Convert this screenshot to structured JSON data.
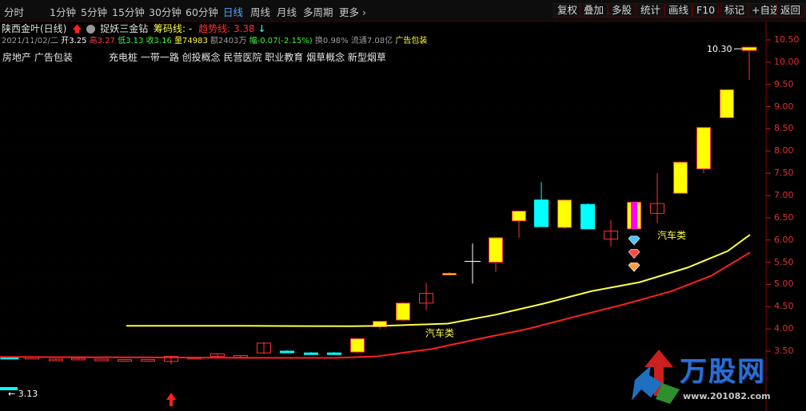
{
  "toolbar": {
    "period_tabs": [
      "分时",
      "1分钟",
      "5分钟",
      "15分钟",
      "30分钟",
      "60分钟",
      "日线",
      "周线",
      "月线",
      "多周期",
      "更多"
    ],
    "active_tab": "日线",
    "right_buttons": [
      "复权",
      "叠加",
      "多股",
      "统计",
      "画线",
      "F10",
      "标记",
      "+自选",
      "返回"
    ]
  },
  "header": {
    "stock": "陕西金叶(日线)",
    "indicator": "捉妖三金钻",
    "chip_label": "筹码线: -",
    "trend_label": "趋势线:",
    "trend_value": "3.38",
    "info_date": "2021/11/02/二",
    "info_open": "开3.25",
    "info_high": "高3.27",
    "info_low": "低3.13",
    "info_close": "收3.16",
    "info_vol": "量74983",
    "info_amt": "额2403万",
    "info_chg": "幅-0.07(-2.15%)",
    "info_turn": "换0.98%",
    "info_float": "流通7.08亿",
    "info_concept": "广告包装"
  },
  "concepts": {
    "left": "房地产 广告包装",
    "right": "充电桩 一带一路 创投概念 民营医院 职业教育 烟草概念 新型烟草"
  },
  "price_axis": [
    "10.50",
    "10.00",
    "9.50",
    "9.00",
    "8.50",
    "8.00",
    "7.50",
    "7.00",
    "6.50",
    "6.00",
    "5.50",
    "5.00",
    "4.50",
    "4.00",
    "3.50"
  ],
  "annotations": {
    "high_label": "10.30",
    "low_label": "3.13",
    "tag1": "汽车类",
    "tag2": "汽车类"
  },
  "watermark": {
    "text": "万股网",
    "url": "www.201082.com"
  },
  "colors": {
    "up": "#ffff00",
    "down": "#00ffff",
    "up_line": "#ff3232",
    "ma_yellow": "#ffff40",
    "ma_red": "#ff2020",
    "magenta": "#ff00ff"
  }
}
